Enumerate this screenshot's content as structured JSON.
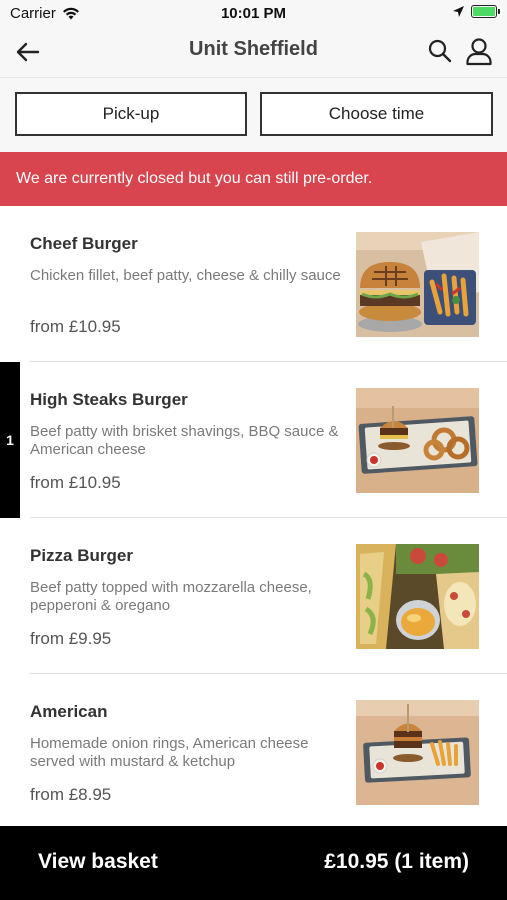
{
  "status_bar": {
    "carrier": "Carrier",
    "time": "10:01 PM"
  },
  "header": {
    "title": "Unit Sheffield",
    "back_icon": "arrow-left-icon",
    "search_icon": "search-icon",
    "user_icon": "user-icon"
  },
  "options": {
    "pickup_label": "Pick-up",
    "time_label": "Choose time"
  },
  "banner": {
    "text": "We are currently closed but you can still pre-order.",
    "color": "#d9454f"
  },
  "menu": {
    "items": [
      {
        "name": "Cheef Burger",
        "description": "Chicken fillet, beef patty, cheese & chilly sauce",
        "price": "from £10.95"
      },
      {
        "name": "High Steaks Burger",
        "description": "Beef patty with brisket shavings, BBQ sauce & American cheese",
        "price": "from £10.95",
        "quantity": "1"
      },
      {
        "name": "Pizza Burger",
        "description": "Beef patty topped with mozzarella cheese, pepperoni & oregano",
        "price": "from £9.95"
      },
      {
        "name": "American",
        "description": "Homemade onion rings, American cheese served with mustard & ketchup",
        "price": "from £8.95"
      }
    ]
  },
  "basket": {
    "label": "View basket",
    "total": "£10.95 (1 item)"
  }
}
